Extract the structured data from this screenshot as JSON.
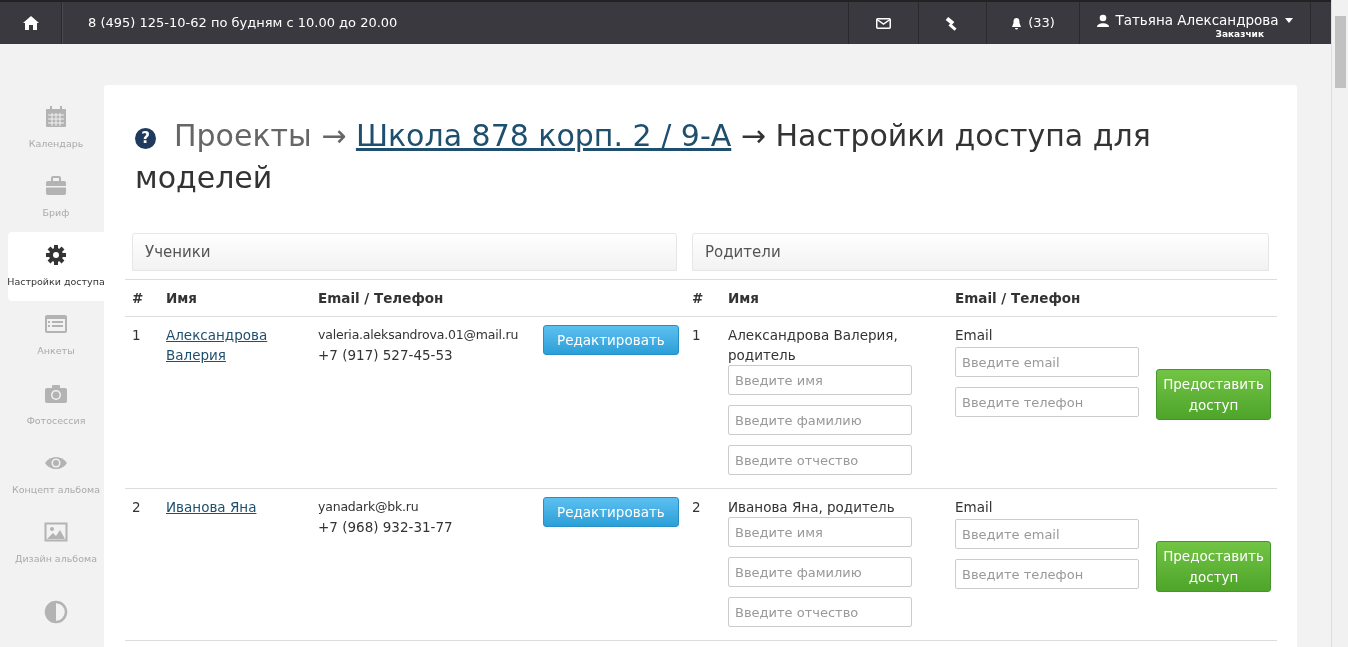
{
  "topbar": {
    "phone": "8 (495) 125-10-62 по будням с 10.00 до 20.00",
    "notifications": "(33)",
    "user_name": "Татьяна Александрова",
    "user_role": "Заказчик"
  },
  "sidebar": {
    "items": [
      {
        "kind": "calendar",
        "label": "Календарь",
        "selected": false
      },
      {
        "kind": "briefcase",
        "label": "Бриф",
        "selected": false
      },
      {
        "kind": "gear",
        "label": "Настройки доступа",
        "selected": true
      },
      {
        "kind": "list",
        "label": "Анкеты",
        "selected": false
      },
      {
        "kind": "camera",
        "label": "Фотосессия",
        "selected": false
      },
      {
        "kind": "eye",
        "label": "Концепт альбома",
        "selected": false
      },
      {
        "kind": "image",
        "label": "Дизайн альбома",
        "selected": false
      },
      {
        "kind": "contrast",
        "selected": false
      }
    ]
  },
  "title": {
    "help_icon": "?",
    "prefix": "Проекты →",
    "link": "Школа 878 корп. 2 / 9-А",
    "suffix": "→ Настройки доступа для моделей"
  },
  "sections": [
    "Ученики",
    "Родители"
  ],
  "table": {
    "columns": [
      "#",
      "Имя",
      "Email / Телефон",
      "",
      "#",
      "Имя",
      "Email / Телефон",
      ""
    ],
    "rows": [
      {
        "num": "1",
        "name": "Александрова Валерия",
        "email": "valeria.aleksandrova.01@mail.ru",
        "phone": "+7 (917) 527-45-53",
        "edit": "Редактировать",
        "parent": {
          "num": "1",
          "name": "Александрова Валерия, родитель",
          "fields": [
            {
              "placeholder": "Введите имя"
            },
            {
              "placeholder": "Введите фамилию"
            },
            {
              "placeholder": "Введите отчество"
            }
          ],
          "email_label": "Email",
          "email_placeholder": "Введите email",
          "phone_placeholder": "Введите телефон",
          "button": "Предоставить доступ"
        }
      },
      {
        "num": "2",
        "name": "Иванова Яна",
        "email": "yanadark@bk.ru",
        "phone": "+7 (968) 932-31-77",
        "edit": "Редактировать",
        "parent": {
          "num": "2",
          "name": "Иванова Яна, родитель",
          "fields": [
            {
              "placeholder": "Введите имя"
            },
            {
              "placeholder": "Введите фамилию"
            },
            {
              "placeholder": "Введите отчество"
            }
          ],
          "email_label": "Email",
          "email_placeholder": "Введите email",
          "phone_placeholder": "Введите телефон",
          "button": "Предоставить доступ"
        }
      }
    ]
  }
}
